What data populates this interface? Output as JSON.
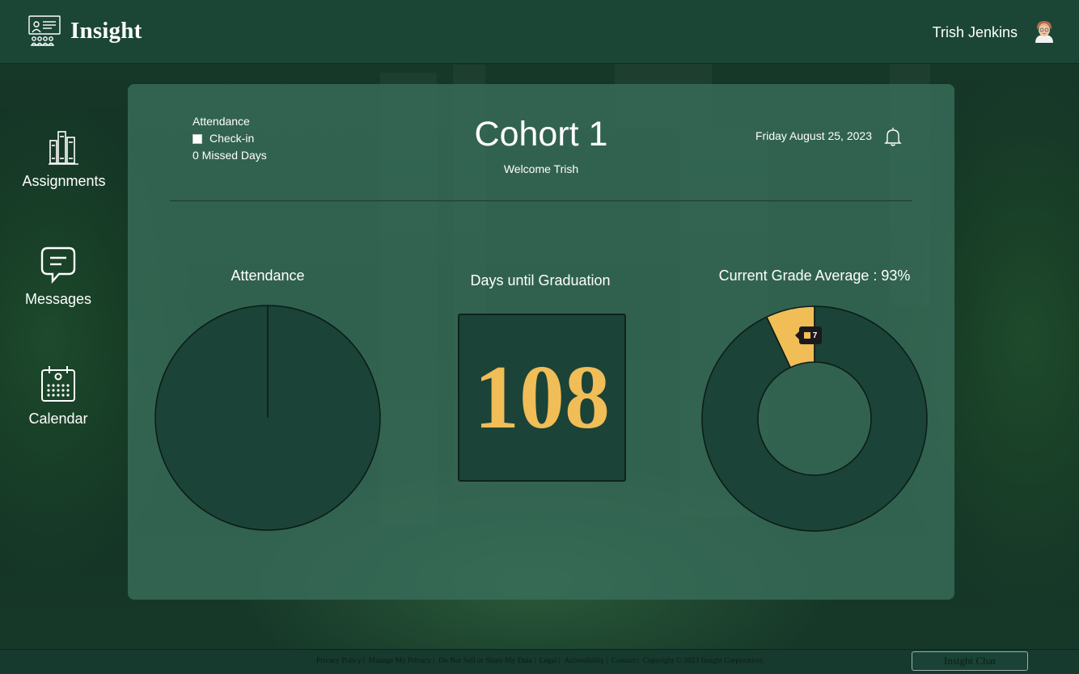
{
  "app": {
    "title": "Insight"
  },
  "user": {
    "name": "Trish Jenkins"
  },
  "nav": {
    "items": [
      {
        "label": "Assignments",
        "icon": "books-icon"
      },
      {
        "label": "Messages",
        "icon": "chat-bubble-icon"
      },
      {
        "label": "Calendar",
        "icon": "calendar-icon"
      }
    ]
  },
  "dashboard": {
    "attendance_heading": "Attendance",
    "checkin_label": "Check-in",
    "missed_days": "0 Missed Days",
    "cohort_title": "Cohort 1",
    "welcome": "Welcome Trish",
    "date": "Friday August 25, 2023",
    "attendance_chart_title": "Attendance",
    "graduation_title": "Days until Graduation",
    "graduation_days": "108",
    "grade_title": "Current Grade Average : 93%",
    "grade_tooltip_value": "7"
  },
  "colors": {
    "accent": "#f0bd57",
    "card": "#3a705c",
    "dark_green": "#1b4337"
  },
  "chart_data": [
    {
      "type": "pie",
      "title": "Attendance",
      "values": [
        100
      ]
    },
    {
      "type": "pie",
      "title": "Current Grade Average : 93%",
      "values": [
        93,
        7
      ],
      "colors": [
        "#1b4337",
        "#f0bd57"
      ]
    }
  ],
  "footer": {
    "links": [
      "Privacy Policy |",
      "Manage My Privacy |",
      "Do Not Sell or Share My Data |",
      "Legal |",
      "Accessibility |",
      "Contact |",
      "Copyright © 2023 Insight Corporation|"
    ],
    "chat_button": "Insight Chat"
  }
}
